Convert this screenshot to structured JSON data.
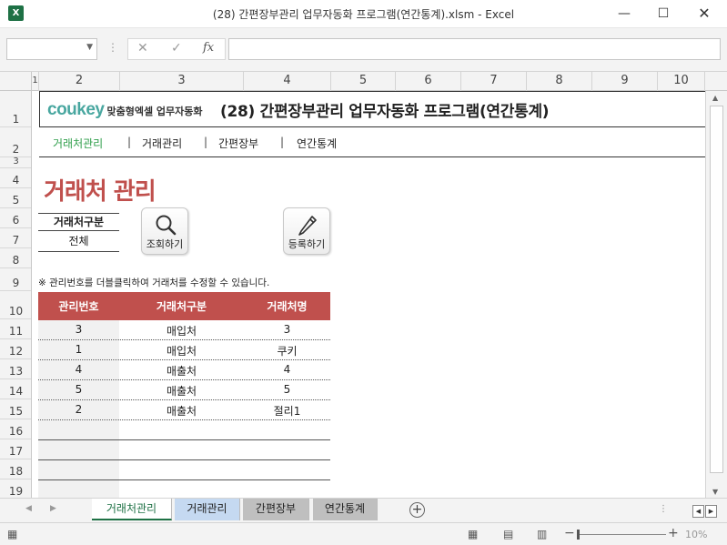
{
  "window": {
    "title": "(28) 간편장부관리 업무자동화 프로그램(연간통계).xlsm - Excel",
    "app_icon": "X",
    "min_glyph": "—",
    "max_glyph": "☐",
    "close_glyph": "✕"
  },
  "formula_bar": {
    "name_box_value": "",
    "cancel_glyph": "✕",
    "enter_glyph": "✓",
    "fx_label": "fx",
    "formula_value": ""
  },
  "columns": [
    "1",
    "2",
    "3",
    "4",
    "5",
    "6",
    "7",
    "8",
    "9",
    "10"
  ],
  "rows": [
    "1",
    "2",
    "3",
    "4",
    "5",
    "6",
    "7",
    "8",
    "9",
    "10",
    "11",
    "12",
    "13",
    "14",
    "15",
    "16",
    "17",
    "18",
    "19"
  ],
  "sheet": {
    "logo_main": "coukey",
    "logo_sub": "맞춤형엑셀 업무자동화",
    "doc_title": "(28) 간편장부관리 업무자동화 프로그램(연간통계)",
    "nav": [
      "거래처관리",
      "거래관리",
      "간편장부",
      "연간통계"
    ],
    "nav_separator": "|",
    "page_heading": "거래처 관리",
    "filter_label": "거래처구분",
    "filter_value": "전체",
    "search_button": "조회하기",
    "register_button": "등록하기",
    "note": "※ 관리번호를 더블클릭하여 거래처를 수정할 수 있습니다.",
    "table_headers": [
      "관리번호",
      "거래처구분",
      "거래처명"
    ],
    "table_rows": [
      [
        "3",
        "매입처",
        "3"
      ],
      [
        "1",
        "매입처",
        "쿠키"
      ],
      [
        "4",
        "매출처",
        "4"
      ],
      [
        "5",
        "매출처",
        "5"
      ],
      [
        "2",
        "매출처",
        "절리1"
      ]
    ],
    "header_color": "#c0504d",
    "accent_color": "#2e9e4a"
  },
  "tabs": [
    "거래처관리",
    "거래관리",
    "간편장부",
    "연간통계"
  ],
  "active_tab": "거래처관리",
  "tab_colors": [
    "#ffffff",
    "#c5d9f1",
    "#bfbfbf",
    "#bfbfbf"
  ],
  "status": {
    "zoom_level": "10%",
    "zoom_minus": "−",
    "zoom_plus": "+"
  }
}
